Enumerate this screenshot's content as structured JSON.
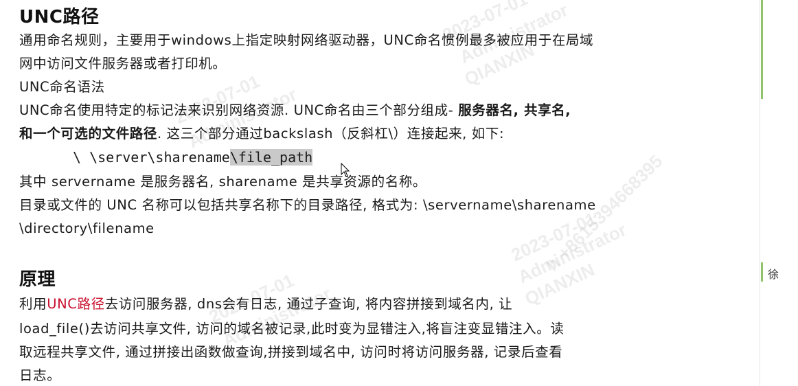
{
  "document": {
    "section1": {
      "title": "UNC路径",
      "para1": {
        "line1": "通用命名规则，主要用于windows上指定映射网络驱动器，UNC命名惯例最多被应用于在局域",
        "line2": "网中访问文件服务器或者打印机。"
      },
      "syntax_label": "UNC命名语法",
      "para2": {
        "line1_normal": "UNC命名使用特定的标记法来识别网络资源. UNC命名由三个部分组成- ",
        "line1_bold": "服务器名, 共享名,",
        "line2_bold": "和一个可选的文件路径",
        "line2_normal": ". 这三个部分通过backslash（反斜杠\\）连接起来, 如下:"
      },
      "example": {
        "prefix": "\\ \\server\\sharename",
        "selected": "\\file_path"
      },
      "para3": "其中 servername 是服务器名, sharename 是共享资源的名称。",
      "para4": {
        "line1": "目录或文件的 UNC 名称可以包括共享名称下的目录路径, 格式为: \\servername\\sharename",
        "line2": "\\directory\\filename"
      }
    },
    "section2": {
      "title": "原理",
      "para1": {
        "line1_pre": "利用",
        "line1_red": "UNC路径",
        "line1_post": "去访问服务器, dns会有日志, 通过子查询, 将内容拼接到域名内, 让",
        "line2": "load_file()去访问共享文件, 访问的域名被记录,此时变为显错注入,将盲注变显错注入。读",
        "line3": "取远程共享文件, 通过拼接出函数做查询,拼接到域名中, 访问时将访问服务器, 记录后查看",
        "line4": "日志。"
      }
    }
  },
  "sidebar": {
    "label": "徐"
  },
  "watermarks": [
    "2023-07-01",
    "Administrator",
    "QIANXIN",
    "h +8615394668395"
  ],
  "colors": {
    "accent_red": "#c8102e",
    "green_bar": "#8fc46a",
    "selection": "#c9c9c9"
  }
}
